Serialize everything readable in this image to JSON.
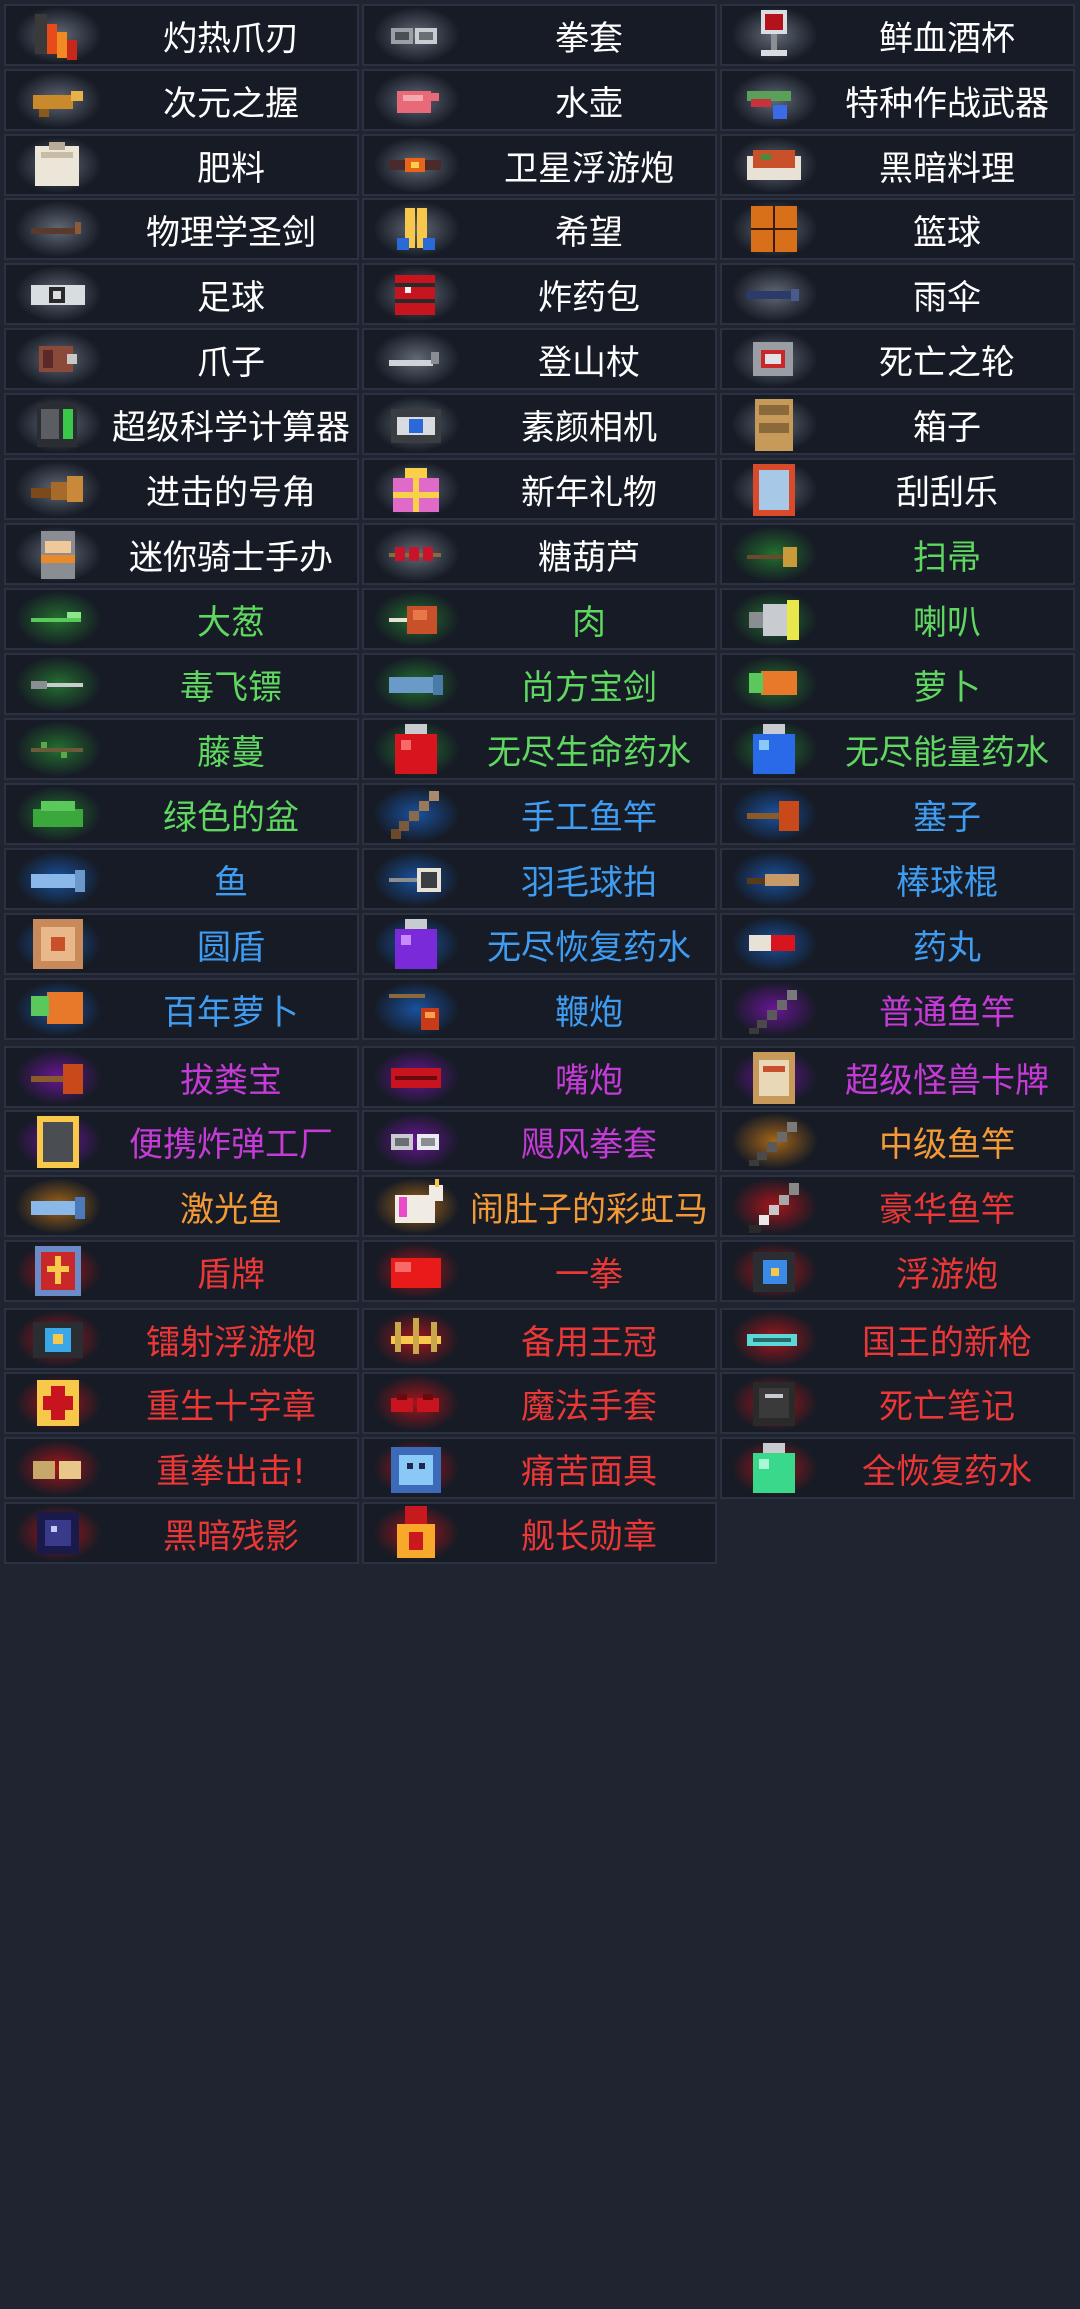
{
  "rarity_colors": {
    "white": "#ffffff",
    "green": "#5fd760",
    "blue": "#3f9cf0",
    "purple": "#c43bd5",
    "orange": "#f39a36",
    "red": "#ec3737"
  },
  "items": [
    {
      "name": "灼热爪刃",
      "rarity": "white",
      "icon": "flaming-claw-icon"
    },
    {
      "name": "拳套",
      "rarity": "white",
      "icon": "gauntlets-icon"
    },
    {
      "name": "鲜血酒杯",
      "rarity": "white",
      "icon": "blood-chalice-icon"
    },
    {
      "name": "次元之握",
      "rarity": "white",
      "icon": "dimension-grip-icon"
    },
    {
      "name": "水壶",
      "rarity": "white",
      "icon": "kettle-icon"
    },
    {
      "name": "特种作战武器",
      "rarity": "white",
      "icon": "special-weapon-icon"
    },
    {
      "name": "肥料",
      "rarity": "white",
      "icon": "fertilizer-bag-icon"
    },
    {
      "name": "卫星浮游炮",
      "rarity": "white",
      "icon": "satellite-drone-icon"
    },
    {
      "name": "黑暗料理",
      "rarity": "white",
      "icon": "dark-dish-icon"
    },
    {
      "name": "物理学圣剑",
      "rarity": "white",
      "icon": "crowbar-icon"
    },
    {
      "name": "希望",
      "rarity": "white",
      "icon": "praying-hands-icon"
    },
    {
      "name": "篮球",
      "rarity": "white",
      "icon": "basketball-icon"
    },
    {
      "name": "足球",
      "rarity": "white",
      "icon": "football-icon"
    },
    {
      "name": "炸药包",
      "rarity": "white",
      "icon": "dynamite-pack-icon"
    },
    {
      "name": "雨伞",
      "rarity": "white",
      "icon": "umbrella-icon"
    },
    {
      "name": "爪子",
      "rarity": "white",
      "icon": "claw-icon"
    },
    {
      "name": "登山杖",
      "rarity": "white",
      "icon": "hiking-stick-icon"
    },
    {
      "name": "死亡之轮",
      "rarity": "white",
      "icon": "death-wheel-icon"
    },
    {
      "name": "超级科学计算器",
      "rarity": "white",
      "icon": "calculator-icon"
    },
    {
      "name": "素颜相机",
      "rarity": "white",
      "icon": "camera-icon"
    },
    {
      "name": "箱子",
      "rarity": "white",
      "icon": "crate-icon"
    },
    {
      "name": "进击的号角",
      "rarity": "white",
      "icon": "horn-icon"
    },
    {
      "name": "新年礼物",
      "rarity": "white",
      "icon": "gift-box-icon"
    },
    {
      "name": "刮刮乐",
      "rarity": "white",
      "icon": "scratch-card-icon"
    },
    {
      "name": "迷你骑士手办",
      "rarity": "white",
      "icon": "knight-figure-icon"
    },
    {
      "name": "糖葫芦",
      "rarity": "white",
      "icon": "candied-haws-icon"
    },
    {
      "name": "扫帚",
      "rarity": "green",
      "icon": "broom-icon"
    },
    {
      "name": "大葱",
      "rarity": "green",
      "icon": "scallion-icon"
    },
    {
      "name": "肉",
      "rarity": "green",
      "icon": "meat-icon"
    },
    {
      "name": "喇叭",
      "rarity": "green",
      "icon": "megaphone-icon"
    },
    {
      "name": "毒飞镖",
      "rarity": "green",
      "icon": "poison-dart-icon"
    },
    {
      "name": "尚方宝剑",
      "rarity": "green",
      "icon": "fish-sword-icon"
    },
    {
      "name": "萝卜",
      "rarity": "green",
      "icon": "carrot-icon"
    },
    {
      "name": "藤蔓",
      "rarity": "green",
      "icon": "vine-icon"
    },
    {
      "name": "无尽生命药水",
      "rarity": "green",
      "icon": "red-potion-icon"
    },
    {
      "name": "无尽能量药水",
      "rarity": "green",
      "icon": "blue-potion-icon"
    },
    {
      "name": "绿色的盆",
      "rarity": "green",
      "icon": "green-basin-icon"
    },
    {
      "name": "手工鱼竿",
      "rarity": "blue",
      "icon": "handmade-rod-icon"
    },
    {
      "name": "塞子",
      "rarity": "blue",
      "icon": "plunger-icon"
    },
    {
      "name": "鱼",
      "rarity": "blue",
      "icon": "fish-icon"
    },
    {
      "name": "羽毛球拍",
      "rarity": "blue",
      "icon": "badminton-racket-icon"
    },
    {
      "name": "棒球棍",
      "rarity": "blue",
      "icon": "baseball-bat-icon"
    },
    {
      "name": "圆盾",
      "rarity": "blue",
      "icon": "round-shield-icon"
    },
    {
      "name": "无尽恢复药水",
      "rarity": "blue",
      "icon": "purple-potion-icon"
    },
    {
      "name": "药丸",
      "rarity": "blue",
      "icon": "pill-icon"
    },
    {
      "name": "百年萝卜",
      "rarity": "blue",
      "icon": "old-carrot-icon"
    },
    {
      "name": "鞭炮",
      "rarity": "blue",
      "icon": "firecracker-icon"
    },
    {
      "name": "普通鱼竿",
      "rarity": "purple",
      "icon": "fishing-rod-icon"
    },
    {
      "name": "拔粪宝",
      "rarity": "purple",
      "icon": "plunger-icon"
    },
    {
      "name": "嘴炮",
      "rarity": "purple",
      "icon": "lips-icon"
    },
    {
      "name": "超级怪兽卡牌",
      "rarity": "purple",
      "icon": "monster-card-icon"
    },
    {
      "name": "便携炸弹工厂",
      "rarity": "purple",
      "icon": "bomb-factory-icon"
    },
    {
      "name": "飓风拳套",
      "rarity": "purple",
      "icon": "hurricane-gauntlets-icon"
    },
    {
      "name": "中级鱼竿",
      "rarity": "orange",
      "icon": "fishing-rod-icon"
    },
    {
      "name": "激光鱼",
      "rarity": "orange",
      "icon": "laser-fish-icon"
    },
    {
      "name": "闹肚子的彩虹马",
      "rarity": "orange",
      "icon": "unicorn-icon"
    },
    {
      "name": "豪华鱼竿",
      "rarity": "red",
      "icon": "deluxe-rod-icon"
    },
    {
      "name": "盾牌",
      "rarity": "red",
      "icon": "shield-icon"
    },
    {
      "name": "一拳",
      "rarity": "red",
      "icon": "red-glove-icon"
    },
    {
      "name": "浮游炮",
      "rarity": "red",
      "icon": "drone-turret-icon"
    },
    {
      "name": "镭射浮游炮",
      "rarity": "red",
      "icon": "laser-drone-icon"
    },
    {
      "name": "备用王冠",
      "rarity": "red",
      "icon": "spare-crown-icon"
    },
    {
      "name": "国王的新枪",
      "rarity": "red",
      "icon": "kings-gun-icon"
    },
    {
      "name": "重生十字章",
      "rarity": "red",
      "icon": "rebirth-cross-icon"
    },
    {
      "name": "魔法手套",
      "rarity": "red",
      "icon": "magic-gloves-icon"
    },
    {
      "name": "死亡笔记",
      "rarity": "red",
      "icon": "death-note-icon"
    },
    {
      "name": "重拳出击!",
      "rarity": "red",
      "icon": "heavy-punch-icon"
    },
    {
      "name": "痛苦面具",
      "rarity": "red",
      "icon": "pain-mask-icon"
    },
    {
      "name": "全恢复药水",
      "rarity": "red",
      "icon": "green-potion-icon"
    },
    {
      "name": "黑暗残影",
      "rarity": "red",
      "icon": "dark-orb-icon"
    },
    {
      "name": "舰长勋章",
      "rarity": "red",
      "icon": "captain-medal-icon"
    }
  ]
}
